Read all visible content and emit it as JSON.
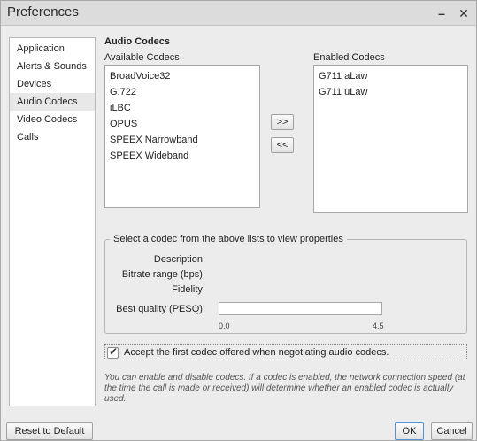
{
  "window": {
    "title": "Preferences",
    "minimize_glyph": "–",
    "close_glyph": "✕"
  },
  "sidebar": {
    "items": [
      {
        "label": "Application"
      },
      {
        "label": "Alerts & Sounds"
      },
      {
        "label": "Devices"
      },
      {
        "label": "Audio Codecs"
      },
      {
        "label": "Video Codecs"
      },
      {
        "label": "Calls"
      }
    ],
    "selected": "Audio Codecs"
  },
  "main": {
    "heading": "Audio Codecs",
    "available_label": "Available Codecs",
    "enabled_label": "Enabled Codecs",
    "available": [
      "BroadVoice32",
      "G.722",
      "iLBC",
      "OPUS",
      "SPEEX Narrowband",
      "SPEEX Wideband"
    ],
    "enabled": [
      "G711 aLaw",
      "G711 uLaw"
    ],
    "add_button": ">>",
    "remove_button": "<<"
  },
  "properties": {
    "legend": "Select a codec from the above lists to view properties",
    "description_label": "Description:",
    "bitrate_label": "Bitrate range (bps):",
    "fidelity_label": "Fidelity:",
    "quality_label": "Best quality (PESQ):",
    "quality_min": "0.0",
    "quality_max": "4.5",
    "quality_value": 0
  },
  "accept_first": {
    "checked": true,
    "label": "Accept the first codec offered when negotiating audio codecs."
  },
  "note": "You can enable and disable codecs. If a codec is enabled, the network connection speed (at the time the call is made or received) will determine whether an enabled codec is actually used.",
  "footer": {
    "reset_label": "Reset to Default",
    "ok_label": "OK",
    "cancel_label": "Cancel"
  },
  "icons": {
    "minimize": "minimize-icon",
    "close": "close-icon",
    "checkmark": "checkmark-icon"
  }
}
